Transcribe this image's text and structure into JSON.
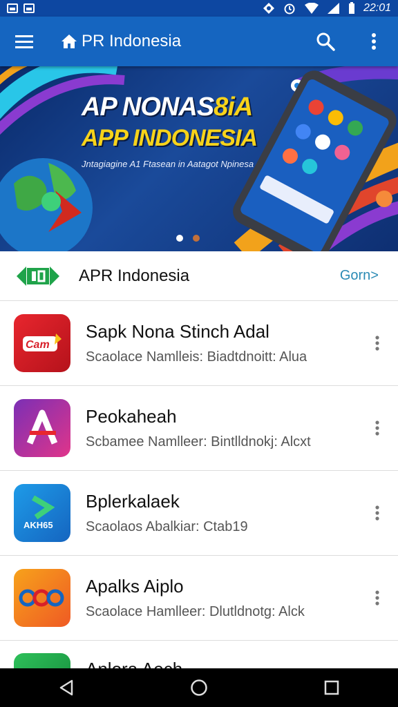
{
  "status_bar": {
    "time": "22:01"
  },
  "app_bar": {
    "title": "PR Indonesia"
  },
  "banner": {
    "title_white": "AP NONAS",
    "title_yellow_suffix": "8iA",
    "title_line2": "APP INDONESIA",
    "subtitle": "Jntagiagine A1 Ftasean in Aatagot Npinesa",
    "slides": 2,
    "active_slide": 1
  },
  "section": {
    "title": "APR Indonesia",
    "more_label": "Gorn>"
  },
  "apps": [
    {
      "name": "Saрk Nona Stinch Adal",
      "meta": "Scaolace Namlleis: Biadtdnoitt: Alua",
      "icon_color": "#d8202a"
    },
    {
      "name": "Peokaheah",
      "meta": "Scbamee Namlleer: Bintlldnokj: Alcxt",
      "icon_color": "#b02a9c"
    },
    {
      "name": "Bplerkalaek",
      "meta": "Scaolaos Abalkiar: Ctab19",
      "icon_color": "#1e7fd8"
    },
    {
      "name": "Apalks Aiplo",
      "meta": "Scaolace Hamlleer: Dlutldnotg: Alck",
      "icon_color": "#f07a22"
    },
    {
      "name": "Anlora Aech",
      "meta": "",
      "icon_color": "#1fa34a"
    }
  ],
  "icons": {
    "menu": "hamburger-icon",
    "home": "home-icon",
    "search": "search-icon",
    "overflow": "more-vert-icon",
    "back": "back-icon",
    "home_nav": "home-circle-icon",
    "recents": "recents-icon"
  },
  "colors": {
    "app_bar": "#1565c0",
    "status_bar": "#0d47a1",
    "accent": "#2a8ab4",
    "banner_yellow": "#f7d31a"
  }
}
